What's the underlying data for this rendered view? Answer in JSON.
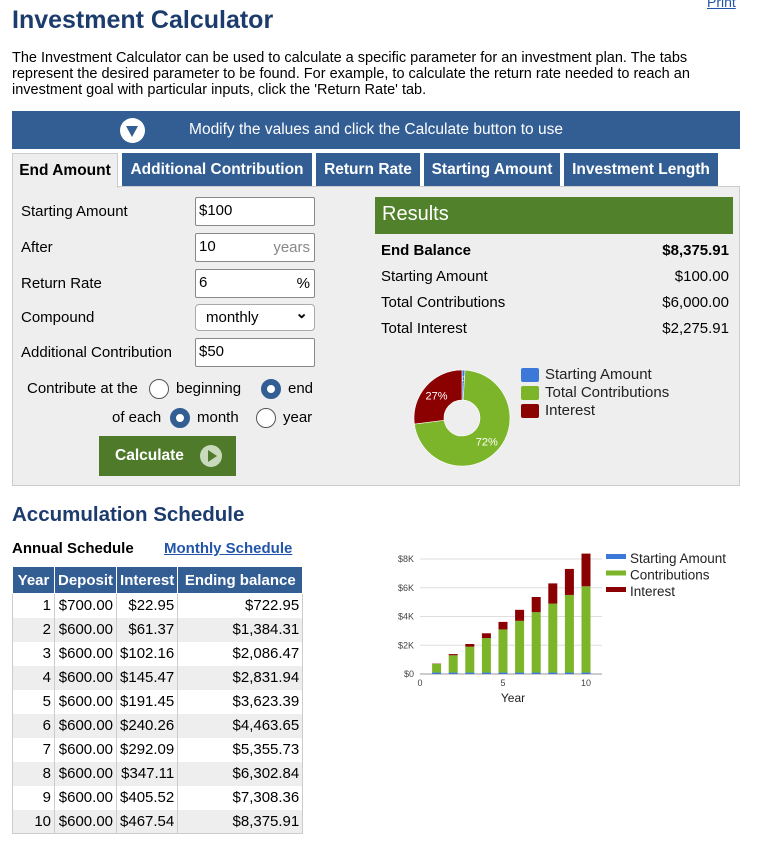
{
  "print_label": "Print",
  "title": "Investment Calculator",
  "description": "The Investment Calculator can be used to calculate a specific parameter for an investment plan. The tabs represent the desired parameter to be found. For example, to calculate the return rate needed to reach an investment goal with particular inputs, click the 'Return Rate' tab.",
  "banner": "Modify the values and click the Calculate button to use",
  "tabs": [
    "End Amount",
    "Additional Contribution",
    "Return Rate",
    "Starting Amount",
    "Investment Length"
  ],
  "form": {
    "starting_amount_label": "Starting Amount",
    "starting_amount": "$100",
    "after_label": "After",
    "after": "10",
    "after_unit": "years",
    "return_rate_label": "Return Rate",
    "return_rate": "6",
    "return_unit": "%",
    "compound_label": "Compound",
    "compound": "monthly",
    "additional_label": "Additional Contribution",
    "additional": "$50",
    "contribute_label": "Contribute at the",
    "beginning": "beginning",
    "end": "end",
    "of_each_label": "of each",
    "month": "month",
    "year": "year",
    "timing_selected": "end",
    "period_selected": "month",
    "calculate": "Calculate"
  },
  "results": {
    "title": "Results",
    "rows": [
      [
        "End Balance",
        "$8,375.91"
      ],
      [
        "Starting Amount",
        "$100.00"
      ],
      [
        "Total Contributions",
        "$6,000.00"
      ],
      [
        "Total Interest",
        "$2,275.91"
      ]
    ]
  },
  "pie": {
    "slices": [
      {
        "name": "Starting Amount",
        "pct": 1,
        "label": "1%",
        "color": "#3b78d8"
      },
      {
        "name": "Total Contributions",
        "pct": 72,
        "label": "72%",
        "color": "#7cb52a"
      },
      {
        "name": "Interest",
        "pct": 27,
        "label": "27%",
        "color": "#8b0000"
      }
    ]
  },
  "schedule": {
    "title": "Accumulation Schedule",
    "annual": "Annual Schedule",
    "monthly": "Monthly Schedule",
    "headers": [
      "Year",
      "Deposit",
      "Interest",
      "Ending balance"
    ],
    "rows": [
      [
        "1",
        "$700.00",
        "$22.95",
        "$722.95"
      ],
      [
        "2",
        "$600.00",
        "$61.37",
        "$1,384.31"
      ],
      [
        "3",
        "$600.00",
        "$102.16",
        "$2,086.47"
      ],
      [
        "4",
        "$600.00",
        "$145.47",
        "$2,831.94"
      ],
      [
        "5",
        "$600.00",
        "$191.45",
        "$3,623.39"
      ],
      [
        "6",
        "$600.00",
        "$240.26",
        "$4,463.65"
      ],
      [
        "7",
        "$600.00",
        "$292.09",
        "$5,355.73"
      ],
      [
        "8",
        "$600.00",
        "$347.11",
        "$6,302.84"
      ],
      [
        "9",
        "$600.00",
        "$405.52",
        "$7,308.36"
      ],
      [
        "10",
        "$600.00",
        "$467.54",
        "$8,375.91"
      ]
    ]
  },
  "chart_data": {
    "type": "bar",
    "stacked": true,
    "xlabel": "Year",
    "ylim": [
      0,
      8000
    ],
    "xlim": [
      0,
      11
    ],
    "yticks": [
      "$0",
      "$2K",
      "$4K",
      "$6K",
      "$8K"
    ],
    "ytick_values": [
      0,
      2000,
      4000,
      6000,
      8000
    ],
    "xticks": [
      0,
      5,
      10
    ],
    "categories": [
      1,
      2,
      3,
      4,
      5,
      6,
      7,
      8,
      9,
      10
    ],
    "legend": "right",
    "series": [
      {
        "name": "Starting Amount",
        "color": "#3b78d8",
        "values": [
          100,
          100,
          100,
          100,
          100,
          100,
          100,
          100,
          100,
          100
        ]
      },
      {
        "name": "Contributions",
        "color": "#7cb52a",
        "values": [
          600,
          1200,
          1800,
          2400,
          3000,
          3600,
          4200,
          4800,
          5400,
          6000
        ]
      },
      {
        "name": "Interest",
        "color": "#8b0000",
        "values": [
          22.95,
          84.31,
          186.47,
          331.94,
          523.39,
          763.65,
          1055.73,
          1402.84,
          1808.36,
          2275.91
        ]
      }
    ]
  }
}
